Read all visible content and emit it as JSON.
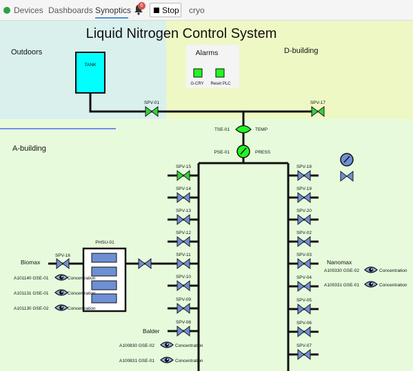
{
  "nav": {
    "items": [
      "Devices",
      "Dashboards",
      "Synoptics",
      "cryo"
    ],
    "active": "Synoptics",
    "notification_count": "0",
    "stop_label": "Stop"
  },
  "colors": {
    "outdoors_bg": "#d9f0ec",
    "dbuilding_bg": "#eef8c4",
    "abuilding_bg": "#e7fbdc",
    "valve_blue": "#6e8fd4",
    "valve_green": "#37d23a",
    "tank_fill": "#00ffff",
    "alarm_ok": "#21f721",
    "nav_underline": "#4a90d9"
  },
  "synoptic": {
    "title": "Liquid Nitrogen Control System",
    "zones": {
      "outdoors": "Outdoors",
      "dbuilding": "D-building",
      "abuilding": "A-building"
    },
    "tank_label": "TANK",
    "alarms": {
      "title": "Alarms",
      "left": "G-CRY",
      "right": "Reset PLC"
    },
    "top_valves": {
      "left": "SPV-01",
      "right": "SPV-17"
    },
    "tse": {
      "id": "TSE-01",
      "label": "TEMP"
    },
    "pse": {
      "id": "PSE-01",
      "label": "PRESS"
    },
    "left_valves": [
      "SPV-15",
      "SPV-14",
      "SPV-13",
      "SPV-12",
      "SPV-11",
      "SPV-10",
      "SPV-09",
      "SPV-08"
    ],
    "right_valves": [
      "SPV-18",
      "SPV-19",
      "SPV-20",
      "SPV-02",
      "SPV-03",
      "SPV-04",
      "SPV-05",
      "SPV-06",
      "SPV-07"
    ],
    "phsu": "PHSU-01",
    "biomax": {
      "label": "Biomax",
      "valve": "SPV-16",
      "sensors": [
        {
          "id": "A101140 GSE-01",
          "label": "Concentration"
        },
        {
          "id": "A101131 GSE-01",
          "label": "Concentration"
        },
        {
          "id": "A101130 GSE-02",
          "label": "Concentration"
        }
      ]
    },
    "nanomax": {
      "label": "Nanomax",
      "sensors": [
        {
          "id": "A100330 GSE-02",
          "label": "Concentration"
        },
        {
          "id": "A100331 GSE-01",
          "label": "Concentration"
        }
      ]
    },
    "balder": {
      "label": "Balder",
      "sensors": [
        {
          "id": "A100830 GSE-02",
          "label": "Concentration"
        },
        {
          "id": "A100831 GSE-01",
          "label": "Concentration"
        }
      ]
    }
  }
}
